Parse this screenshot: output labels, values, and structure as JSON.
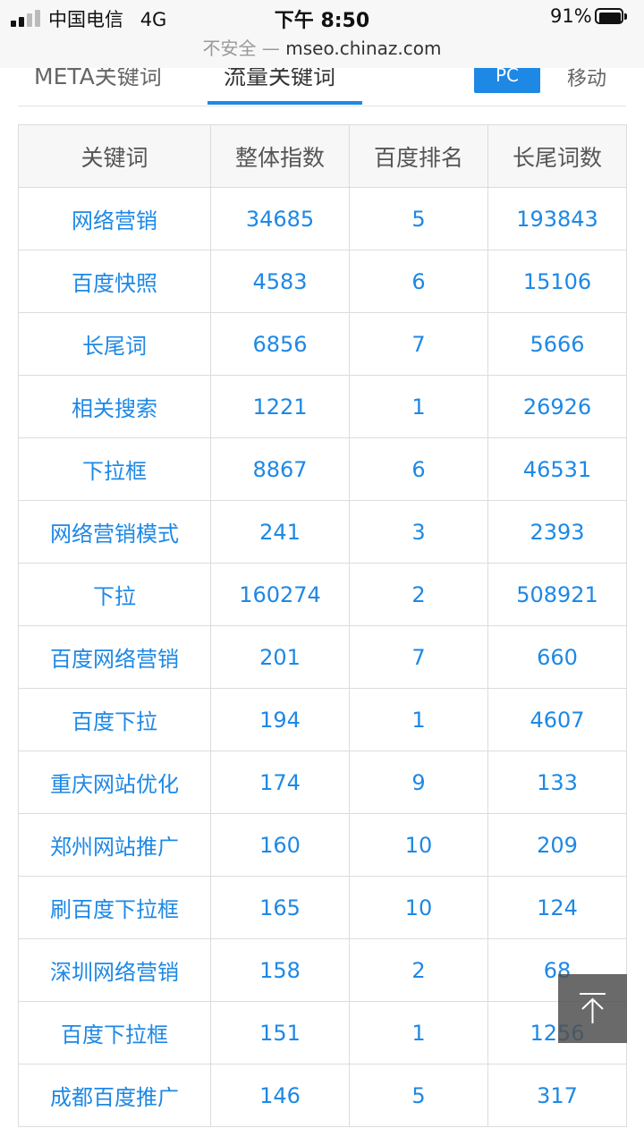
{
  "status_bar": {
    "carrier": "中国电信",
    "network": "4G",
    "time": "下午 8:50",
    "battery_percent": "91%",
    "insecure_label": "不安全 —",
    "url": "mseo.chinaz.com"
  },
  "tabs": {
    "meta_keywords": "META关键词",
    "traffic_keywords": "流量关键词",
    "pc_label": "PC",
    "mobile_label": "移动"
  },
  "table": {
    "headers": [
      "关键词",
      "整体指数",
      "百度排名",
      "长尾词数"
    ],
    "rows": [
      [
        "网络营销",
        "34685",
        "5",
        "193843"
      ],
      [
        "百度快照",
        "4583",
        "6",
        "15106"
      ],
      [
        "长尾词",
        "6856",
        "7",
        "5666"
      ],
      [
        "相关搜索",
        "1221",
        "1",
        "26926"
      ],
      [
        "下拉框",
        "8867",
        "6",
        "46531"
      ],
      [
        "网络营销模式",
        "241",
        "3",
        "2393"
      ],
      [
        "下拉",
        "160274",
        "2",
        "508921"
      ],
      [
        "百度网络营销",
        "201",
        "7",
        "660"
      ],
      [
        "百度下拉",
        "194",
        "1",
        "4607"
      ],
      [
        "重庆网站优化",
        "174",
        "9",
        "133"
      ],
      [
        "郑州网站推广",
        "160",
        "10",
        "209"
      ],
      [
        "刷百度下拉框",
        "165",
        "10",
        "124"
      ],
      [
        "深圳网络营销",
        "158",
        "2",
        "68"
      ],
      [
        "百度下拉框",
        "151",
        "1",
        "1256"
      ],
      [
        "成都百度推广",
        "146",
        "5",
        "317"
      ]
    ]
  },
  "back_to_top": {
    "icon": "arrow-up-to-line-icon"
  },
  "colors": {
    "accent": "#1e88e5",
    "header_bg": "#f7f7f7",
    "border": "#dcdcdc"
  }
}
